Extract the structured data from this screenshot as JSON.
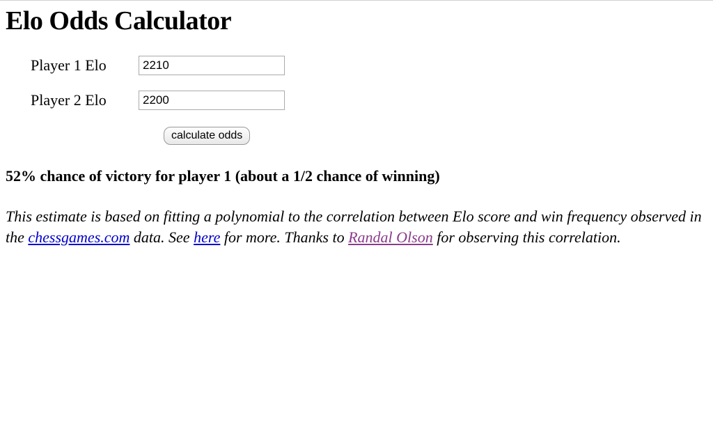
{
  "heading": "Elo Odds Calculator",
  "form": {
    "player1_label": "Player 1 Elo",
    "player1_value": "2210",
    "player2_label": "Player 2 Elo",
    "player2_value": "2200",
    "calculate_button": "calculate odds"
  },
  "result_text": "52% chance of victory for player 1 (about a 1/2 chance of winning)",
  "footnote": {
    "part1": "This estimate is based on fitting a polynomial to the correlation between Elo score and win frequency observed in the ",
    "link1_text": "chessgames.com",
    "part2": " data. See ",
    "link2_text": "here",
    "part3": " for more. Thanks to ",
    "link3_text": "Randal Olson",
    "part4": " for observing this correlation."
  }
}
